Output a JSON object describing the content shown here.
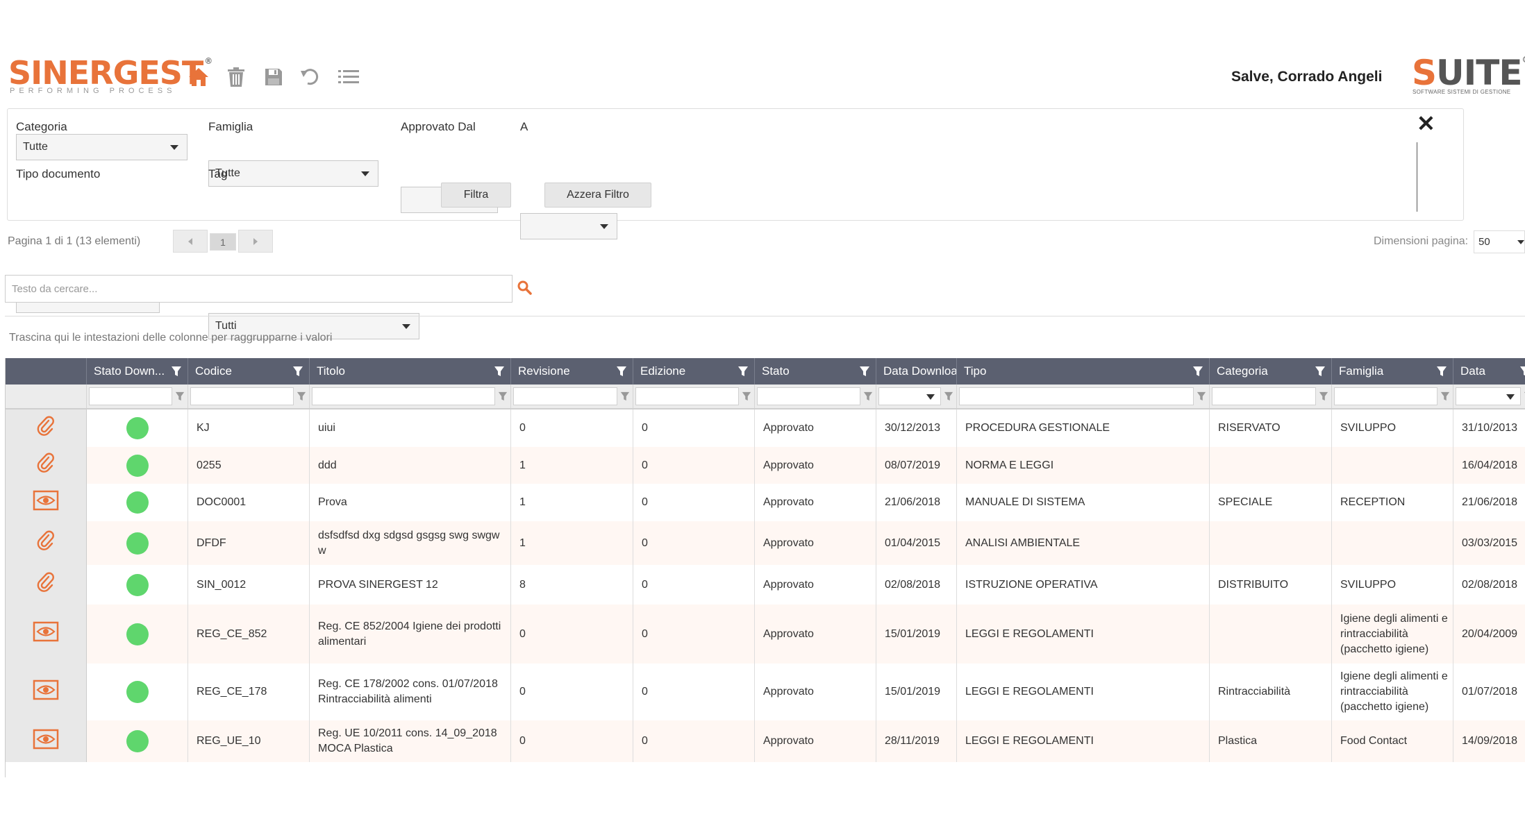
{
  "header": {
    "logo_text": "SINERGEST",
    "logo_reg": "®",
    "logo_sub": "PERFORMING PROCESS",
    "greeting": "Salve, Corrado Angeli",
    "suite_logo_s": "S",
    "suite_logo_rest": "UITE",
    "suite_reg": "®",
    "suite_sub": "SOFTWARE SISTEMI DI GESTIONE",
    "toolbar_icons": [
      "home-icon",
      "trash-icon",
      "save-icon",
      "undo-icon",
      "list-icon"
    ],
    "accent_color": "#e8733a"
  },
  "filters": {
    "categoria_label": "Categoria",
    "categoria_value": "Tutte",
    "famiglia_label": "Famiglia",
    "famiglia_value": "Tutte",
    "approvato_dal_label": "Approvato Dal",
    "approvato_dal_value": "",
    "a_label": "A",
    "a_value": "",
    "tipo_documento_label": "Tipo documento",
    "tipo_documento_value": "Tutti",
    "tag_label": "Tag",
    "tag_value": "Tutti",
    "filtra_button": "Filtra",
    "azzera_button": "Azzera Filtro",
    "close_symbol": "✕"
  },
  "pager": {
    "info": "Pagina 1 di 1 (13 elementi)",
    "current_page": "1",
    "page_size_label": "Dimensioni pagina:",
    "page_size_value": "50"
  },
  "search": {
    "placeholder": "Testo da cercare..."
  },
  "grid": {
    "group_hint": "Trascina qui le intestazioni delle colonne per raggrupparne i valori",
    "columns": [
      "",
      "Stato Down...",
      "Codice",
      "Titolo",
      "Revisione",
      "Edizione",
      "Stato",
      "Data Downloa",
      "Tipo",
      "Categoria",
      "Famiglia",
      "Data"
    ],
    "header_color": "#5b6070",
    "status_color": "#5fd66d",
    "rows": [
      {
        "icon": "paperclip-icon",
        "codice": "KJ",
        "titolo": "uiui",
        "revisione": "0",
        "edizione": "0",
        "stato": "Approvato",
        "data_download": "30/12/2013",
        "tipo": "PROCEDURA GESTIONALE",
        "categoria": "RISERVATO",
        "famiglia": "SVILUPPO",
        "data": "31/10/2013"
      },
      {
        "icon": "paperclip-icon",
        "codice": "0255",
        "titolo": "ddd",
        "revisione": "1",
        "edizione": "0",
        "stato": "Approvato",
        "data_download": "08/07/2019",
        "tipo": "NORMA E LEGGI",
        "categoria": "",
        "famiglia": "",
        "data": "16/04/2018"
      },
      {
        "icon": "eye-icon",
        "codice": "DOC0001",
        "titolo": "Prova",
        "revisione": "1",
        "edizione": "0",
        "stato": "Approvato",
        "data_download": "21/06/2018",
        "tipo": "MANUALE DI SISTEMA",
        "categoria": "SPECIALE",
        "famiglia": "RECEPTION",
        "data": "21/06/2018"
      },
      {
        "icon": "paperclip-icon",
        "codice": "DFDF",
        "titolo": "dsfsdfsd dxg sdgsd gsgsg swg swgw w",
        "revisione": "1",
        "edizione": "0",
        "stato": "Approvato",
        "data_download": "01/04/2015",
        "tipo": "ANALISI AMBIENTALE",
        "categoria": "",
        "famiglia": "",
        "data": "03/03/2015"
      },
      {
        "icon": "paperclip-icon",
        "codice": "SIN_0012",
        "titolo": "PROVA SINERGEST 12",
        "revisione": "8",
        "edizione": "0",
        "stato": "Approvato",
        "data_download": "02/08/2018",
        "tipo": "ISTRUZIONE OPERATIVA",
        "categoria": "DISTRIBUITO",
        "famiglia": "SVILUPPO",
        "data": "02/08/2018"
      },
      {
        "icon": "eye-icon",
        "codice": "REG_CE_852",
        "titolo": "Reg. CE 852/2004 Igiene dei prodotti alimentari",
        "revisione": "0",
        "edizione": "0",
        "stato": "Approvato",
        "data_download": "15/01/2019",
        "tipo": "LEGGI E REGOLAMENTI",
        "categoria": "",
        "famiglia": "Igiene degli alimenti e rintracciabilità (pacchetto igiene)",
        "data": "20/04/2009"
      },
      {
        "icon": "eye-icon",
        "codice": "REG_CE_178",
        "titolo": "Reg. CE 178/2002 cons. 01/07/2018 Rintracciabilità alimenti",
        "revisione": "0",
        "edizione": "0",
        "stato": "Approvato",
        "data_download": "15/01/2019",
        "tipo": "LEGGI E REGOLAMENTI",
        "categoria": "Rintracciabilità",
        "famiglia": "Igiene degli alimenti e rintracciabilità (pacchetto igiene)",
        "data": "01/07/2018"
      },
      {
        "icon": "eye-icon",
        "codice": "REG_UE_10",
        "titolo": "Reg. UE 10/2011 cons. 14_09_2018 MOCA Plastica",
        "revisione": "0",
        "edizione": "0",
        "stato": "Approvato",
        "data_download": "28/11/2019",
        "tipo": "LEGGI E REGOLAMENTI",
        "categoria": "Plastica",
        "famiglia": "Food Contact",
        "data": "14/09/2018"
      }
    ]
  }
}
